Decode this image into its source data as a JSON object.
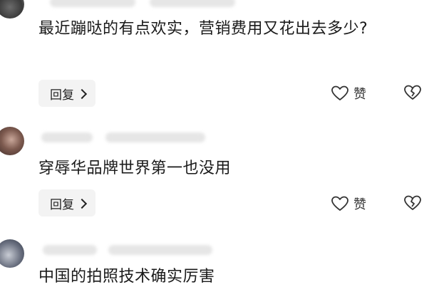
{
  "comments": [
    {
      "text": "最近蹦哒的有点欢实，营销费用又花出去多少?",
      "reply_label": "回复",
      "like_label": "赞"
    },
    {
      "text": "穿辱华品牌世界第一也没用",
      "reply_label": "回复",
      "like_label": "赞"
    },
    {
      "text": "中国的拍照技术确实厉害"
    }
  ],
  "icons": {
    "like": "heart-icon",
    "dislike": "broken-heart-icon",
    "reply_arrow": "chevron-right-icon"
  },
  "colors": {
    "reply_bg": "#f3f3f3",
    "text": "#1a1a1a",
    "icon": "#333333"
  }
}
